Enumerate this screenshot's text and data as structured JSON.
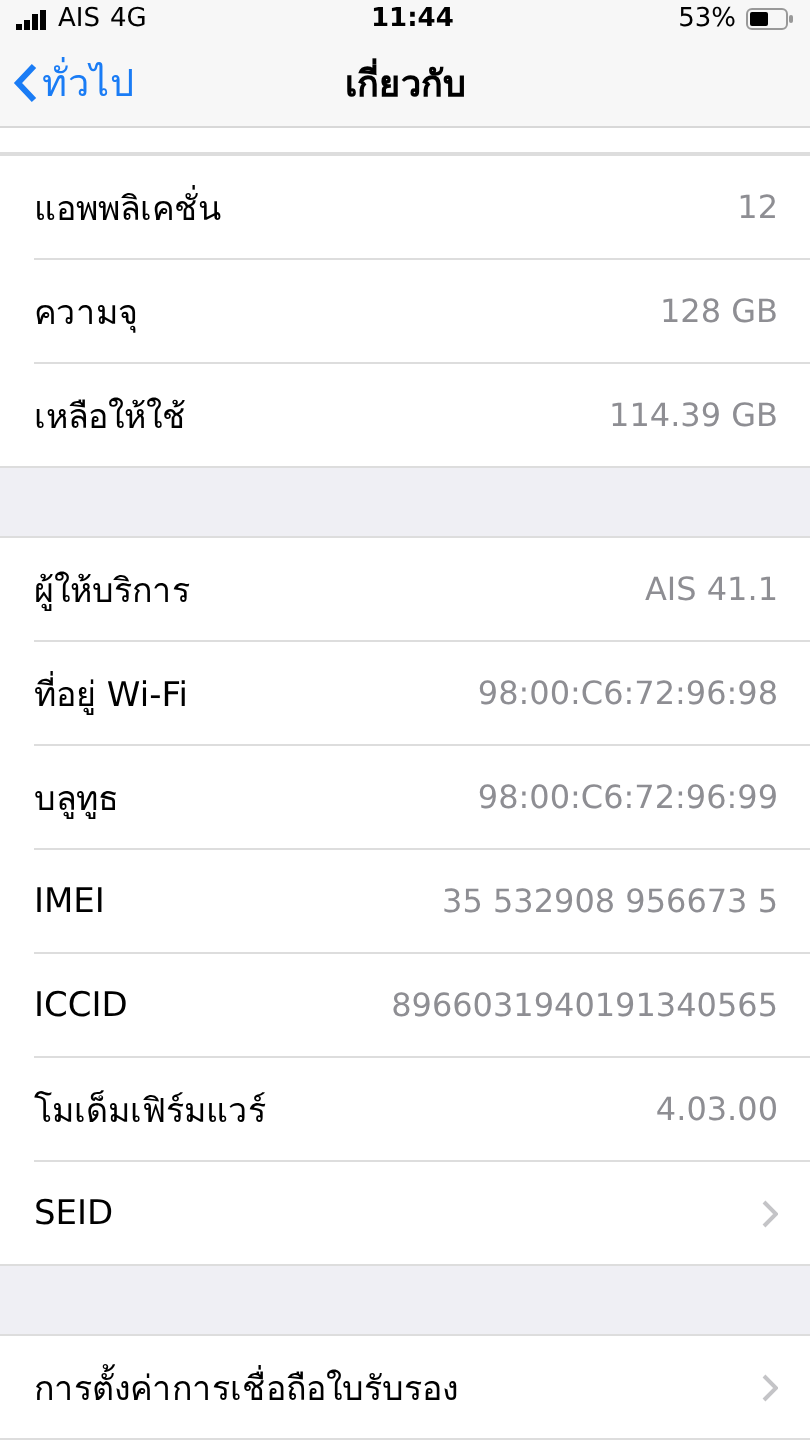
{
  "status_bar": {
    "carrier": "AIS",
    "network": "4G",
    "time": "11:44",
    "battery": "53%"
  },
  "nav": {
    "back": "ทั่วไป",
    "title": "เกี่ยวกับ"
  },
  "groups": [
    {
      "rows": [
        {
          "kind": "value",
          "label": "แอพพลิเคชั่น",
          "value": "12"
        },
        {
          "kind": "value",
          "label": "ความจุ",
          "value": "128 GB"
        },
        {
          "kind": "value",
          "label": "เหลือให้ใช้",
          "value": "114.39 GB"
        }
      ]
    },
    {
      "rows": [
        {
          "kind": "value",
          "label": "ผู้ให้บริการ",
          "value": "AIS 41.1"
        },
        {
          "kind": "value",
          "label": "ที่อยู่ Wi-Fi",
          "value": "98:00:C6:72:96:98"
        },
        {
          "kind": "value",
          "label": "บลูทูธ",
          "value": "98:00:C6:72:96:99"
        },
        {
          "kind": "value",
          "label": "IMEI",
          "value": "35 532908 956673 5"
        },
        {
          "kind": "value",
          "label": "ICCID",
          "value": "8966031940191340565"
        },
        {
          "kind": "value",
          "label": "โมเด็มเฟิร์มแวร์",
          "value": "4.03.00"
        },
        {
          "kind": "link",
          "label": "SEID"
        }
      ]
    },
    {
      "rows": [
        {
          "kind": "link",
          "label": "การตั้งค่าการเชื่อถือใบรับรอง"
        }
      ]
    }
  ]
}
